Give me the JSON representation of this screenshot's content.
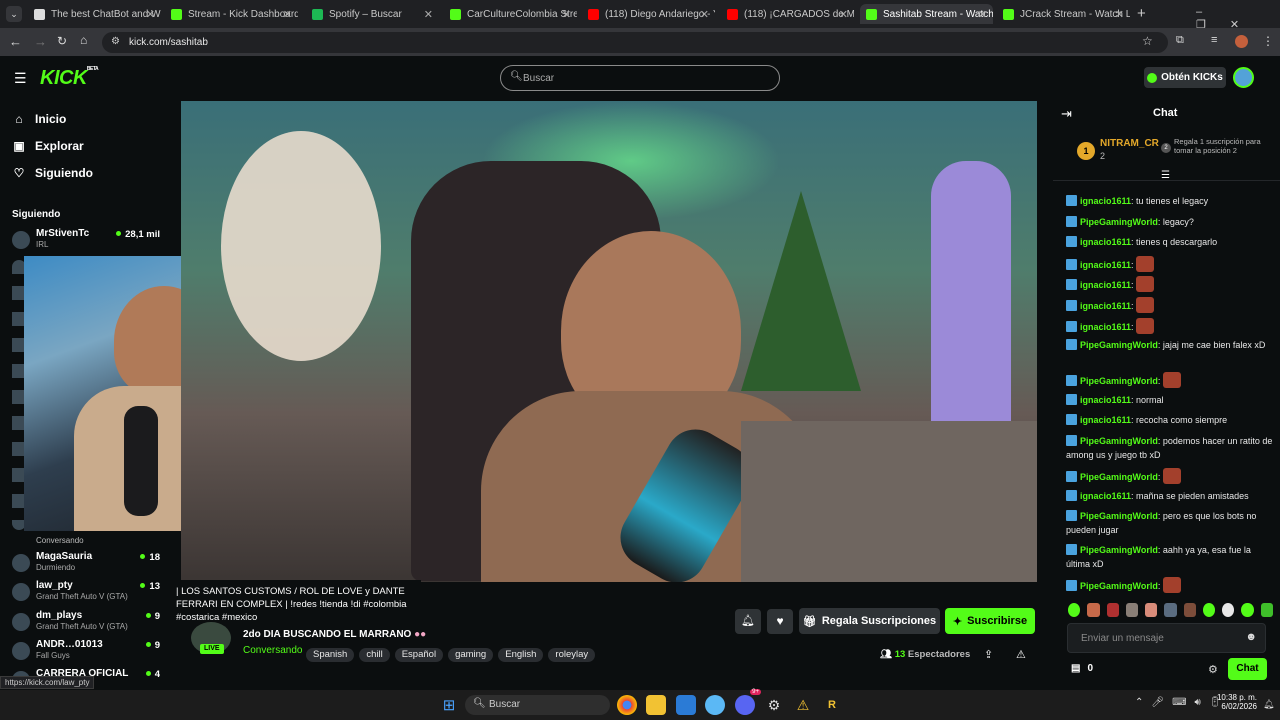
{
  "browser": {
    "tabs": [
      {
        "title": "The best ChatBot and Wi",
        "icon": "shield-icon",
        "active": false
      },
      {
        "title": "Stream - Kick Dashboard",
        "icon": "kick-icon",
        "active": false
      },
      {
        "title": "Spotify – Buscar",
        "icon": "spotify-icon",
        "active": false
      },
      {
        "title": "CarCultureColombia Strea",
        "icon": "kick-icon",
        "active": false
      },
      {
        "title": "(118) Diego Andariego - Y",
        "icon": "youtube-icon",
        "active": false
      },
      {
        "title": "(118) ¡CARGADOS de MA",
        "icon": "youtube-icon",
        "active": false
      },
      {
        "title": "Sashitab Stream - Watch",
        "icon": "kick-icon",
        "active": true
      },
      {
        "title": "JCrack Stream - Watch Li",
        "icon": "kick-icon",
        "active": false
      }
    ],
    "url": "kick.com/sashitab",
    "status_url": "https://kick.com/law_pty"
  },
  "header": {
    "logo": "KICK",
    "logo_badge": "BETA",
    "search_placeholder": "Buscar",
    "get_kicks": "Obtén KICKs"
  },
  "sidebar": {
    "nav": [
      {
        "label": "Inicio",
        "icon": "home-icon"
      },
      {
        "label": "Explorar",
        "icon": "compass-icon"
      },
      {
        "label": "Siguiendo",
        "icon": "heart-icon"
      }
    ],
    "following_title": "Siguiendo",
    "following": [
      {
        "name": "MrStivenTc",
        "game": "IRL",
        "viewers": "28,1 mil"
      },
      {
        "name": "MagaSauria",
        "game": "Durmiendo",
        "viewers": "18"
      },
      {
        "name": "law_pty",
        "game": "Grand Theft Auto V (GTA)",
        "viewers": "13"
      },
      {
        "name": "dm_plays",
        "game": "Grand Theft Auto V (GTA)",
        "viewers": "9"
      },
      {
        "name": "ANDR…01013",
        "game": "Fall Guys",
        "viewers": "9"
      },
      {
        "name": "CARRERA OFICIAL",
        "game": "",
        "viewers": "4"
      }
    ],
    "overlay_label": "Conversando"
  },
  "stream": {
    "tooltip_title": "| LOS SANTOS CUSTOMS / ROL DE LOVE y DANTE FERRARI EN COMPLEX | !redes !tienda !di #colombia #costarica #mexico",
    "title": "2do DIA BUSCANDO EL MARRANO",
    "category": "Conversando",
    "tags": [
      "Spanish",
      "chill",
      "Español",
      "gaming",
      "English",
      "roleylay"
    ],
    "live_badge": "LIVE",
    "viewers": "13",
    "viewers_label": "Espectadores",
    "gift_subs_label": "Regala Suscripciones",
    "subscribe_label": "Suscribirse"
  },
  "chat": {
    "title": "Chat",
    "top_gifter": {
      "rank": "1",
      "name": "NITRAM_CR",
      "count": "2"
    },
    "next_rank": {
      "rank": "2",
      "text": "Regala 1 suscripción para tomar la posición 2"
    },
    "messages": [
      {
        "user": "ignacio1611",
        "text": "tu tienes el legacy"
      },
      {
        "user": "PipeGamingWorld",
        "text": "legacy?"
      },
      {
        "user": "ignacio1611",
        "text": "tienes q descargarlo"
      },
      {
        "user": "ignacio1611",
        "text": "",
        "emote": true
      },
      {
        "user": "ignacio1611",
        "text": "",
        "emote": true
      },
      {
        "user": "ignacio1611",
        "text": "",
        "emote": true
      },
      {
        "user": "ignacio1611",
        "text": "",
        "emote": true
      },
      {
        "user": "PipeGamingWorld",
        "text": "jajaj me cae bien falex xD"
      },
      {
        "user": "PipeGamingWorld",
        "text": "",
        "emote": true
      },
      {
        "user": "ignacio1611",
        "text": "normal"
      },
      {
        "user": "ignacio1611",
        "text": "recocha como siempre"
      },
      {
        "user": "PipeGamingWorld",
        "text": "podemos hacer un ratito de among us y juego tb xD"
      },
      {
        "user": "PipeGamingWorld",
        "text": "",
        "emote": true
      },
      {
        "user": "ignacio1611",
        "text": "mañna se pieden amistades"
      },
      {
        "user": "PipeGamingWorld",
        "text": "pero es que los bots no pueden jugar"
      },
      {
        "user": "PipeGamingWorld",
        "text": "aahh ya ya, esa fue la última xD"
      },
      {
        "user": "PipeGamingWorld",
        "text": "",
        "emote": true
      }
    ],
    "input_placeholder": "Enviar un mensaje",
    "points": "0",
    "send_label": "Chat"
  },
  "taskbar": {
    "search": "Buscar",
    "time": "10:38 p. m.",
    "date": "6/02/2026",
    "discord_badge": "9+"
  },
  "colors": {
    "brand": "#53fc18",
    "background": "#0b0e0f",
    "chat_user": "#53fc18"
  }
}
